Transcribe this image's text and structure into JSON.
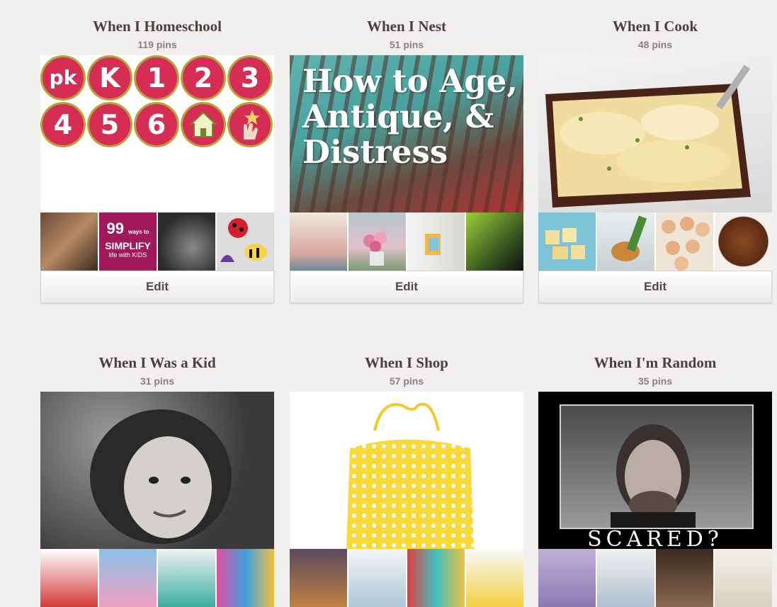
{
  "boards": [
    {
      "title": "When I Homeschool",
      "count": "119 pins",
      "edit_label": "Edit"
    },
    {
      "title": "When I Nest",
      "count": "51 pins",
      "edit_label": "Edit"
    },
    {
      "title": "When I Cook",
      "count": "48 pins",
      "edit_label": "Edit"
    },
    {
      "title": "When I Was a Kid",
      "count": "31 pins"
    },
    {
      "title": "When I Shop",
      "count": "57 pins"
    },
    {
      "title": "When I'm Random",
      "count": "35 pins"
    }
  ],
  "covers": {
    "homeschool_badges": [
      "pk",
      "K",
      "1",
      "2",
      "3",
      "4",
      "5",
      "6",
      "house-icon",
      "hand-star-icon"
    ],
    "nest_text": "How to Age, Antique, & Distress",
    "random_caption": "SCARED?"
  },
  "thumbs": {
    "homeschool_simplify": {
      "big": "99",
      "small": "ways to",
      "word": "SIMPLIFY",
      "tail": "life with KIDS"
    }
  }
}
